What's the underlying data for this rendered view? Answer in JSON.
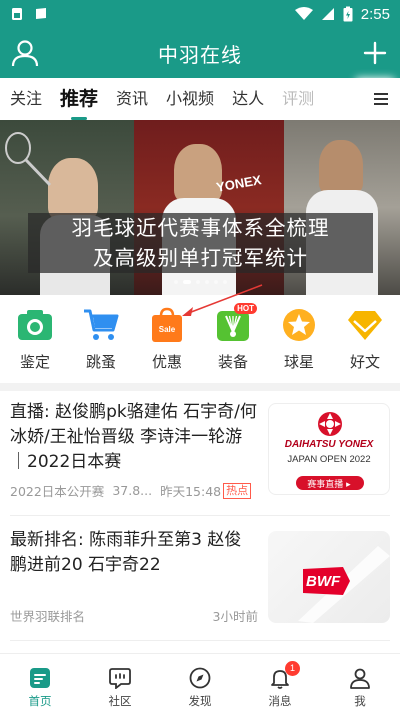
{
  "status_bar": {
    "time": "2:55"
  },
  "header": {
    "title": "中羽在线"
  },
  "tabs": [
    {
      "label": "关注"
    },
    {
      "label": "推荐"
    },
    {
      "label": "资讯"
    },
    {
      "label": "小视频"
    },
    {
      "label": "达人"
    },
    {
      "label": "评测"
    }
  ],
  "banner": {
    "caption_line1": "羽毛球近代赛事体系全梳理",
    "caption_line2": "及高级别单打冠军统计",
    "photo_text": "YONEX"
  },
  "quick_links": [
    {
      "label": "鉴定",
      "icon": "camera-icon",
      "color": "#2bb673"
    },
    {
      "label": "跳蚤",
      "icon": "cart-icon",
      "color": "#2f8ff0"
    },
    {
      "label": "优惠",
      "icon": "sale-bag-icon",
      "color": "#ff7a1a",
      "icon_text": "Sale"
    },
    {
      "label": "装备",
      "icon": "shuttlecock-icon",
      "color": "#55c232",
      "badge": "HOT"
    },
    {
      "label": "球星",
      "icon": "star-icon",
      "color": "#ffb020"
    },
    {
      "label": "好文",
      "icon": "diamond-icon",
      "color": "#f7b500"
    }
  ],
  "news": [
    {
      "title": "直播: 赵俊鹏pk骆建佑 石宇奇/何冰娇/王祉怡晋级 李诗沣一轮游｜2022日本赛",
      "source": "2022日本公开赛",
      "views": "37.8...",
      "time": "昨天15:48",
      "tag": "热点",
      "thumb": {
        "brand": "DAIHATSU YONEX",
        "event": "JAPAN OPEN 2022",
        "button": "赛事直播 ▸"
      }
    },
    {
      "title": "最新排名: 陈雨菲升至第3 赵俊鹏进前20 石宇奇22",
      "source": "世界羽联排名",
      "time": "3小时前",
      "thumb": {
        "brand": "BWF"
      }
    }
  ],
  "bottom_nav": [
    {
      "label": "首页",
      "icon": "home-icon",
      "active": true
    },
    {
      "label": "社区",
      "icon": "community-icon"
    },
    {
      "label": "发现",
      "icon": "compass-icon"
    },
    {
      "label": "消息",
      "icon": "bell-icon",
      "badge": "1"
    },
    {
      "label": "我",
      "icon": "profile-icon"
    }
  ],
  "colors": {
    "primary": "#1a9a88",
    "hot": "#ff3b30",
    "annotation": "#e53935"
  }
}
